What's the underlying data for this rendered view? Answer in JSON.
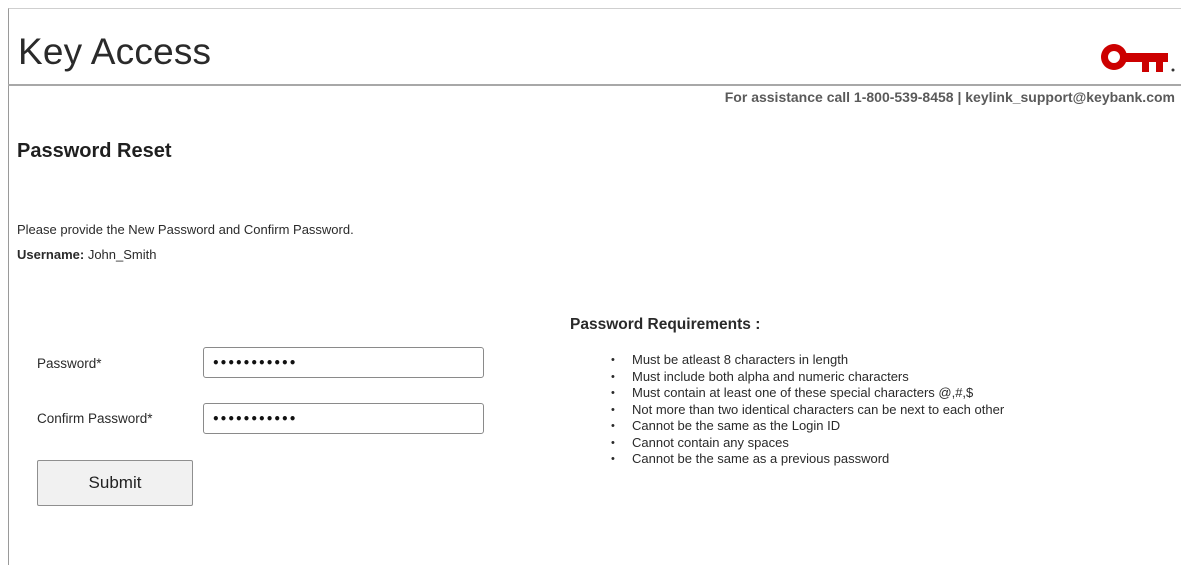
{
  "header": {
    "app_title": "Key Access",
    "assistance": "For assistance call 1-800-539-8458 | keylink_support@keybank.com",
    "logo_color": "#cc0000"
  },
  "page": {
    "title": "Password Reset",
    "instruction": "Please provide the New Password and Confirm Password.",
    "username_label": "Username:",
    "username_value": "John_Smith"
  },
  "form": {
    "password_label": "Password*",
    "password_value": "•••••••••••",
    "confirm_label": "Confirm Password*",
    "confirm_value": "•••••••••••",
    "submit_label": "Submit"
  },
  "requirements": {
    "title": "Password Requirements :",
    "items": [
      "Must be atleast 8 characters in length",
      "Must include both alpha and numeric characters",
      "Must contain at least one of these special characters @,#,$",
      "Not more than two identical characters can be next to each other",
      "Cannot be the same as the Login ID",
      "Cannot contain any spaces",
      "Cannot be the same as a previous password"
    ]
  }
}
